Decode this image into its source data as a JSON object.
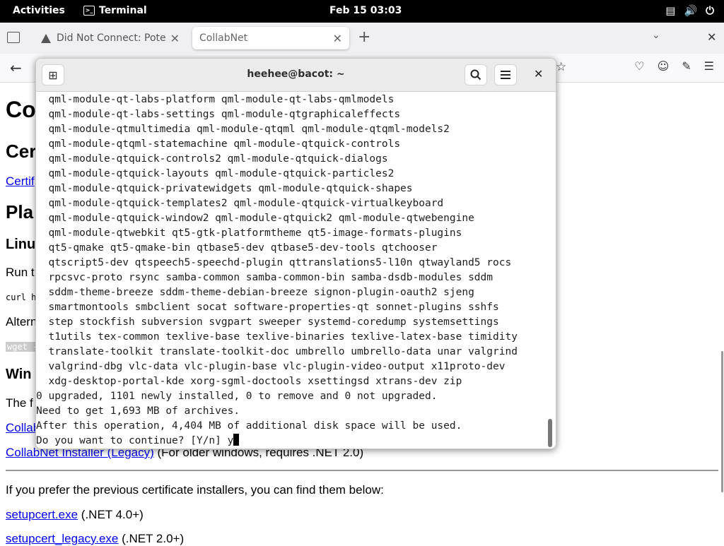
{
  "topbar": {
    "activities": "Activities",
    "app_name": "Terminal",
    "clock": "Feb 15  03:03",
    "tray_icons": [
      "network-icon",
      "volume-icon",
      "power-icon"
    ]
  },
  "browser": {
    "tabs": [
      {
        "title": "Did Not Connect: Potenti",
        "icon": "warning-icon",
        "active": false
      },
      {
        "title": "CollabNet",
        "active": true
      }
    ]
  },
  "page": {
    "heading1": "Co",
    "heading2": "Cer",
    "link_cert": "Certif",
    "heading_platform": "Pla",
    "heading_linux": "Linu",
    "run_text": "Run t",
    "curl_text": "curl h",
    "alt_text": "Altern",
    "wget_text": "wget -",
    "heading_windows": "Win",
    "the_text": "The f",
    "link_collab": "Collab",
    "legacy_link": "CollabNet Installer (Legacy)",
    "legacy_note": " (For older windows, requires .NET 2.0)",
    "prefer_text": "If you prefer the previous certificate installers, you can find them below:",
    "setupcert_link": "setupcert.exe",
    "setupcert_note": " (.NET 4.0+)",
    "setupcert_legacy_link": "setupcert_legacy.exe",
    "setupcert_legacy_note": " (.NET 2.0+)"
  },
  "terminal": {
    "title": "heehee@bacot: ~",
    "lines": [
      "  qml-module-qt-labs-platform qml-module-qt-labs-qmlmodels",
      "  qml-module-qt-labs-settings qml-module-qtgraphicaleffects",
      "  qml-module-qtmultimedia qml-module-qtqml qml-module-qtqml-models2",
      "  qml-module-qtqml-statemachine qml-module-qtquick-controls",
      "  qml-module-qtquick-controls2 qml-module-qtquick-dialogs",
      "  qml-module-qtquick-layouts qml-module-qtquick-particles2",
      "  qml-module-qtquick-privatewidgets qml-module-qtquick-shapes",
      "  qml-module-qtquick-templates2 qml-module-qtquick-virtualkeyboard",
      "  qml-module-qtquick-window2 qml-module-qtquick2 qml-module-qtwebengine",
      "  qml-module-qtwebkit qt5-gtk-platformtheme qt5-image-formats-plugins",
      "  qt5-qmake qt5-qmake-bin qtbase5-dev qtbase5-dev-tools qtchooser",
      "  qtscript5-dev qtspeech5-speechd-plugin qttranslations5-l10n qtwayland5 rocs",
      "  rpcsvc-proto rsync samba-common samba-common-bin samba-dsdb-modules sddm",
      "  sddm-theme-breeze sddm-theme-debian-breeze signon-plugin-oauth2 sjeng",
      "  smartmontools smbclient socat software-properties-qt sonnet-plugins sshfs",
      "  step stockfish subversion svgpart sweeper systemd-coredump systemsettings",
      "  t1utils tex-common texlive-base texlive-binaries texlive-latex-base timidity",
      "  translate-toolkit translate-toolkit-doc umbrello umbrello-data unar valgrind",
      "  valgrind-dbg vlc-data vlc-plugin-base vlc-plugin-video-output x11proto-dev",
      "  xdg-desktop-portal-kde xorg-sgml-doctools xsettingsd xtrans-dev zip",
      "0 upgraded, 1101 newly installed, 0 to remove and 0 not upgraded.",
      "Need to get 1,693 MB of archives.",
      "After this operation, 4,404 MB of additional disk space will be used."
    ],
    "prompt": "Do you want to continue? [Y/n] y"
  }
}
